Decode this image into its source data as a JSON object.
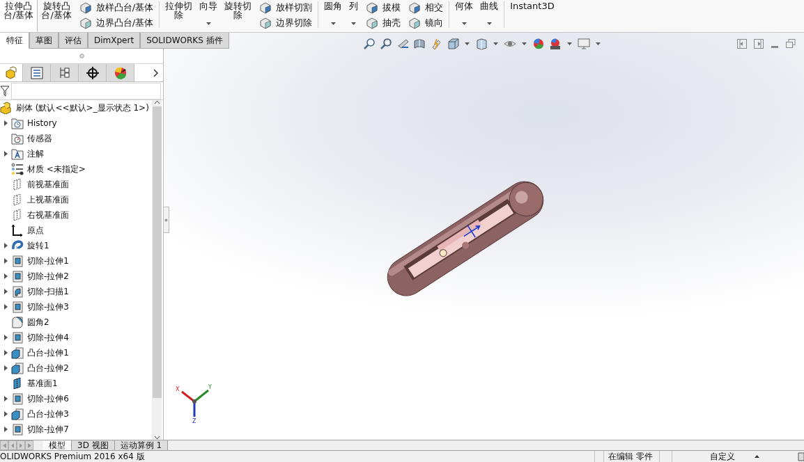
{
  "ribbon": {
    "groups": [
      [
        {
          "kind": "large",
          "lines": [
            "拉伸凸",
            "台/基体"
          ],
          "selected": true,
          "dropdown": false
        },
        {
          "kind": "large",
          "lines": [
            "旋转凸",
            "台/基体"
          ],
          "selected": false,
          "dropdown": false
        },
        {
          "kind": "stack",
          "items": [
            {
              "label": "放样凸台/基体"
            },
            {
              "label": "边界凸台/基体"
            }
          ]
        }
      ],
      [
        {
          "kind": "large",
          "lines": [
            "拉伸切",
            "除"
          ],
          "selected": false,
          "dropdown": false
        },
        {
          "kind": "large",
          "lines": [
            "向导"
          ],
          "selected": false,
          "dropdown": true
        },
        {
          "kind": "large",
          "lines": [
            "旋转切",
            "除"
          ],
          "selected": false,
          "dropdown": false
        },
        {
          "kind": "stack",
          "items": [
            {
              "label": "放样切割"
            },
            {
              "label": "边界切除"
            }
          ]
        }
      ],
      [
        {
          "kind": "large",
          "lines": [
            "圆角"
          ],
          "selected": false,
          "dropdown": true
        },
        {
          "kind": "large",
          "lines": [
            "列"
          ],
          "selected": false,
          "dropdown": true
        },
        {
          "kind": "stack",
          "items": [
            {
              "label": "拔模"
            },
            {
              "label": "抽壳"
            }
          ]
        },
        {
          "kind": "stack",
          "items": [
            {
              "label": "相交"
            },
            {
              "label": "镜向"
            }
          ]
        }
      ],
      [
        {
          "kind": "large",
          "lines": [
            "何体"
          ],
          "selected": false,
          "dropdown": true
        },
        {
          "kind": "large",
          "lines": [
            "曲线"
          ],
          "selected": false,
          "dropdown": true
        }
      ],
      [
        {
          "kind": "large",
          "lines": [
            "Instant3D"
          ],
          "selected": false,
          "dropdown": false
        }
      ]
    ]
  },
  "command_tabs": [
    {
      "label": "特征",
      "selected": true
    },
    {
      "label": "草图",
      "selected": false
    },
    {
      "label": "评估",
      "selected": false
    },
    {
      "label": "DimXpert",
      "selected": false
    },
    {
      "label": "SOLIDWORKS 插件",
      "selected": false
    }
  ],
  "panel": {
    "tabs": [
      {
        "kind": "feature-tree",
        "selected": true
      },
      {
        "kind": "property",
        "selected": false
      },
      {
        "kind": "config",
        "selected": false
      },
      {
        "kind": "target",
        "selected": false
      },
      {
        "kind": "display",
        "selected": false
      }
    ],
    "tree": {
      "label": "刷体  (默认<<默认>_显示状态 1>)",
      "kind": "part",
      "children": [
        {
          "label": "History",
          "kind": "history",
          "collapsible": true
        },
        {
          "label": "传感器",
          "kind": "sensor",
          "collapsible": false
        },
        {
          "label": "注解",
          "kind": "annotation",
          "collapsible": true
        },
        {
          "label": "材质 <未指定>",
          "kind": "material",
          "collapsible": false
        },
        {
          "label": "前视基准面",
          "kind": "plane",
          "collapsible": false
        },
        {
          "label": "上视基准面",
          "kind": "plane",
          "collapsible": false
        },
        {
          "label": "右视基准面",
          "kind": "plane",
          "collapsible": false
        },
        {
          "label": "原点",
          "kind": "origin",
          "collapsible": false
        },
        {
          "label": "旋转1",
          "kind": "revolve",
          "collapsible": true
        },
        {
          "label": "切除-拉伸1",
          "kind": "cut",
          "collapsible": true
        },
        {
          "label": "切除-拉伸2",
          "kind": "cut",
          "collapsible": true
        },
        {
          "label": "切除-扫描1",
          "kind": "sweep",
          "collapsible": true
        },
        {
          "label": "切除-拉伸3",
          "kind": "cut",
          "collapsible": true
        },
        {
          "label": "圆角2",
          "kind": "fillet",
          "collapsible": false
        },
        {
          "label": "切除-拉伸4",
          "kind": "cut",
          "collapsible": true
        },
        {
          "label": "凸台-拉伸1",
          "kind": "boss",
          "collapsible": true
        },
        {
          "label": "凸台-拉伸2",
          "kind": "boss",
          "collapsible": true
        },
        {
          "label": "基准面1",
          "kind": "ref-plane",
          "collapsible": false
        },
        {
          "label": "切除-拉伸6",
          "kind": "cut",
          "collapsible": true
        },
        {
          "label": "凸台-拉伸3",
          "kind": "boss",
          "collapsible": true
        },
        {
          "label": "切除-拉伸7",
          "kind": "cut",
          "collapsible": true
        }
      ]
    }
  },
  "viewport": {
    "triad": {
      "x": "X",
      "y": "Y",
      "z": "Z"
    }
  },
  "bottom_tabs": [
    {
      "label": "模型",
      "selected": true
    },
    {
      "label": "3D 视图",
      "selected": false
    },
    {
      "label": "运动算例 1",
      "selected": false
    }
  ],
  "status_bar": {
    "product": "OLIDWORKS Premium 2016 x64 版",
    "mode": "在编辑 零件",
    "units": "自定义"
  }
}
